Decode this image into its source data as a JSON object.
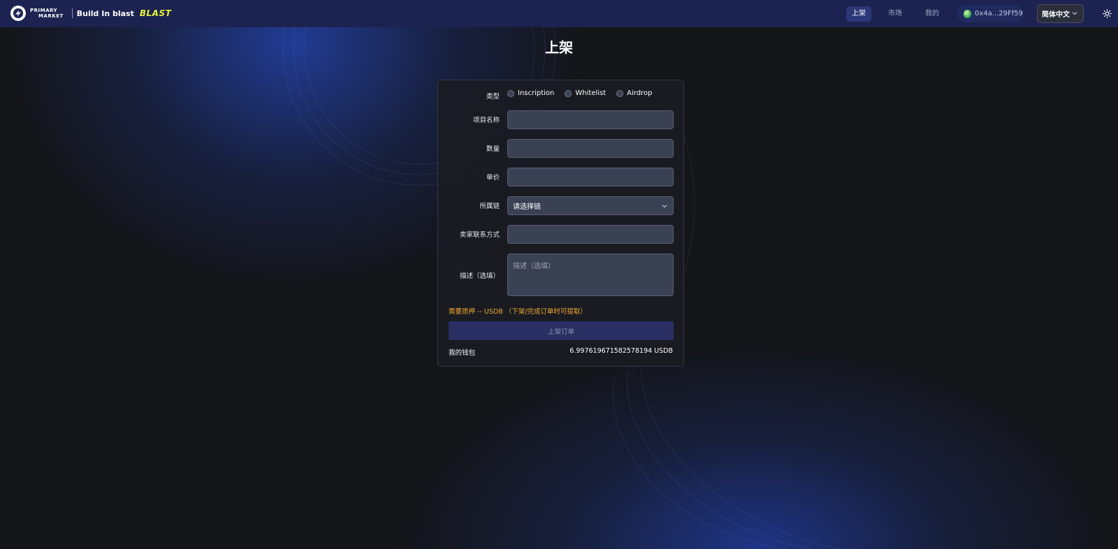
{
  "header": {
    "logo_line1": "PRIMARY",
    "logo_line2": "MARKET",
    "tagline": "Build In blast",
    "brand": "BLAST",
    "nav": [
      {
        "label": "上架",
        "active": true
      },
      {
        "label": "市场",
        "active": false
      },
      {
        "label": "我的",
        "active": false
      }
    ],
    "wallet_address": "0x4a...29Ff59",
    "language": "简体中文",
    "theme_icon": "sun-icon"
  },
  "page": {
    "title": "上架"
  },
  "form": {
    "type_label": "类型",
    "type_options": [
      "Inscription",
      "Whitelist",
      "Airdrop"
    ],
    "project_name_label": "项目名称",
    "project_name_value": "",
    "quantity_label": "数量",
    "quantity_value": "",
    "unit_price_label": "单价",
    "unit_price_value": "",
    "chain_label": "所属链",
    "chain_placeholder": "请选择链",
    "contact_label": "卖家联系方式",
    "contact_value": "",
    "description_label": "描述（选填）",
    "description_placeholder": "描述（选填）",
    "deposit_note": "需要质押 -- USDB （下架/完成订单时可提取）",
    "submit_label": "上架订单",
    "wallet_label": "我的钱包",
    "wallet_balance": "6.997619671582578194 USDB"
  },
  "colors": {
    "header_bg": "#1c2350",
    "accent_blue": "#2c3778",
    "brand_yellow": "#e4f23a",
    "warning_orange": "#f0a830"
  }
}
